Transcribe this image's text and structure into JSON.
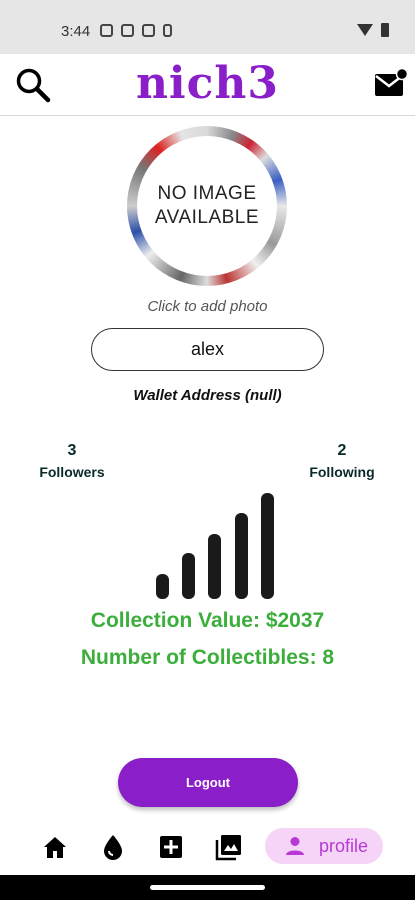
{
  "status_bar": {
    "time": "3:44"
  },
  "header": {
    "brand": "nich3"
  },
  "profile": {
    "avatar_placeholder": "NO IMAGE\nAVAILABLE",
    "add_photo_hint": "Click to add photo",
    "username": "alex",
    "wallet_address": "Wallet Address (null)",
    "followers": {
      "count": "3",
      "label": "Followers"
    },
    "following": {
      "count": "2",
      "label": "Following"
    },
    "collection_value": "Collection Value: $2037",
    "collectibles_count": "Number of Collectibles: 8",
    "logout_label": "Logout"
  },
  "bottom_nav": {
    "items": [
      {
        "icon": "home-icon"
      },
      {
        "icon": "drop-icon"
      },
      {
        "icon": "add-box-icon"
      },
      {
        "icon": "gallery-icon"
      }
    ],
    "active": {
      "icon": "person-icon",
      "label": "profile"
    }
  },
  "colors": {
    "brand": "#8a1ec8",
    "collection_text": "#3cae3c",
    "profile_tab_bg": "#f6d4f8",
    "profile_tab_text": "#b63ad3"
  }
}
